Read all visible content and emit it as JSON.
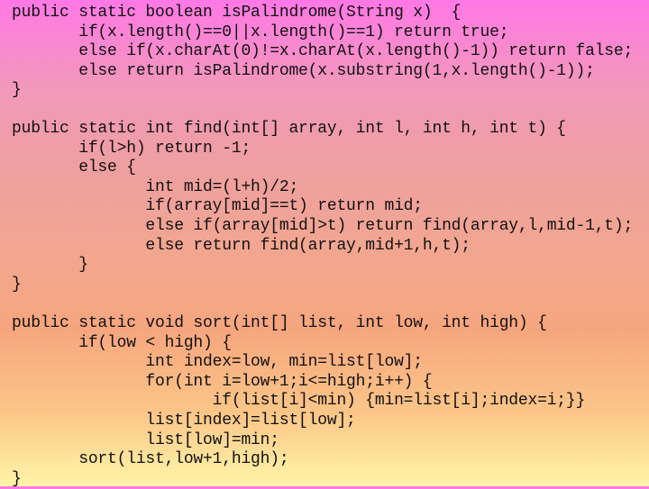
{
  "slide": {
    "background": {
      "top_color": "#ff78e6",
      "middle_color": "#f2a690",
      "bottom_color": "#fff5a8"
    },
    "text_color": "#111111",
    "code_blocks": [
      {
        "name": "isPalindrome",
        "lines": [
          "public static boolean isPalindrome(String x)  {",
          "       if(x.length()==0||x.length()==1) return true;",
          "       else if(x.charAt(0)!=x.charAt(x.length()-1)) return false;",
          "       else return isPalindrome(x.substring(1,x.length()-1));",
          "}"
        ]
      },
      {
        "name": "find",
        "lines": [
          "public static int find(int[] array, int l, int h, int t) {",
          "       if(l>h) return -1;",
          "       else {",
          "              int mid=(l+h)/2;",
          "              if(array[mid]==t) return mid;",
          "              else if(array[mid]>t) return find(array,l,mid-1,t);",
          "              else return find(array,mid+1,h,t);",
          "       }",
          "}"
        ]
      },
      {
        "name": "sort",
        "lines": [
          "public static void sort(int[] list, int low, int high) {",
          "       if(low < high) {",
          "              int index=low, min=list[low];",
          "              for(int i=low+1;i<=high;i++) {",
          "                     if(list[i]<min) {min=list[i];index=i;}}",
          "              list[index]=list[low];",
          "              list[low]=min;",
          "       sort(list,low+1,high);",
          "}"
        ]
      }
    ]
  }
}
